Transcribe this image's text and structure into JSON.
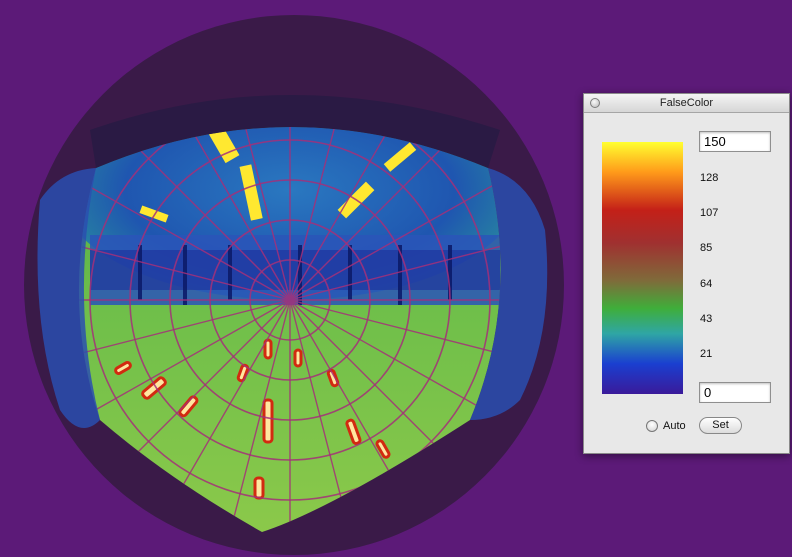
{
  "window": {
    "title": "FalseColor"
  },
  "scale": {
    "max_value": "150",
    "min_value": "0",
    "ticks": [
      "128",
      "107",
      "85",
      "64",
      "43",
      "21"
    ],
    "gradient_stops": [
      "#ffff30",
      "#ff9a1a",
      "#c42018",
      "#a03030",
      "#7f6b3a",
      "#3fae3a",
      "#2fa6a4",
      "#1a3fd0",
      "#3a1a9a"
    ]
  },
  "controls": {
    "auto_label": "Auto",
    "set_label": "Set"
  },
  "colors": {
    "desktop_background": "#5c1a78",
    "fisheye_border": "#3a1a48",
    "grid_lines": "#a5307a"
  }
}
